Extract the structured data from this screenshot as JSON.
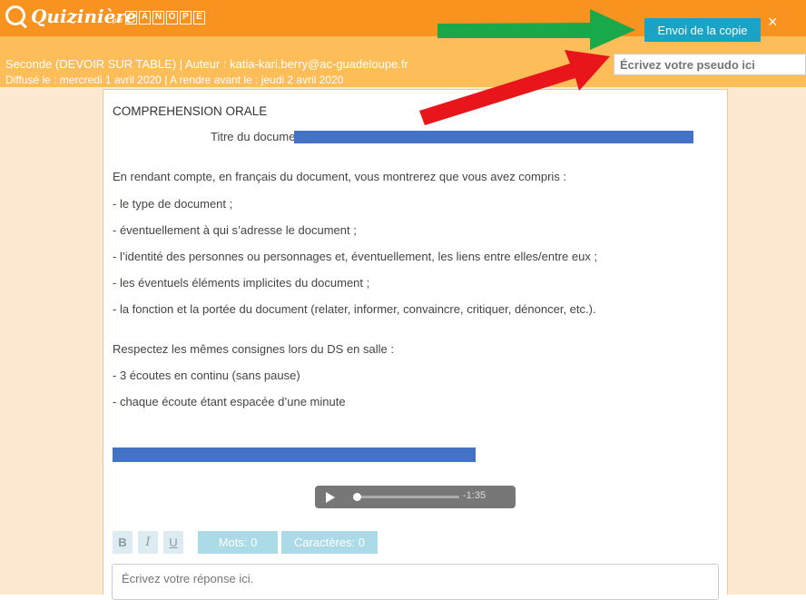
{
  "brand": {
    "name": "Quizinière",
    "par": "par",
    "partner_letters": [
      "C",
      "A",
      "N",
      "O",
      "P",
      "É"
    ]
  },
  "toolbar": {
    "send_label": "Envoi de la copie",
    "close_symbol": "×"
  },
  "header": {
    "meta_line1": "Seconde (DEVOIR SUR TABLE)  | Auteur : katia-kari.berry@ac-guadeloupe.fr",
    "meta_line2": "Diffusé le : mercredi 1 avril 2020  | A rendre avant le : jeudi 2 avril 2020",
    "pseudo_placeholder": "Écrivez votre pseudo ici"
  },
  "content": {
    "heading": "COMPREHENSION ORALE",
    "doc_title_label": "Titre du document : ",
    "intro": "En rendant compte, en français du document, vous montrerez que vous avez compris :",
    "bullets": [
      "- le type de document ;",
      "- éventuellement à qui s’adresse le document ;",
      "- l’identité des personnes ou personnages et, éventuellement, les liens entre elles/entre eux ;",
      "- les éventuels éléments implicites du document ;",
      "- la fonction et la portée du document (relater, informer, convaincre, critiquer, dénoncer, etc.)."
    ],
    "instructions_intro": "Respectez les mêmes consignes lors du DS en salle :",
    "instructions": [
      "- 3 écoutes en continu (sans pause)",
      "- chaque écoute étant espacée d’une minute"
    ]
  },
  "audio": {
    "time_remaining": "-1:35",
    "progress_fraction": 0.02
  },
  "editor": {
    "bold": "B",
    "italic": "I",
    "underline": "U",
    "words_label": "Mots: 0",
    "chars_label": "Caractères: 0",
    "answer_placeholder": "Écrivez votre réponse ici."
  },
  "colors": {
    "brand_orange": "#f7931e",
    "header_light_orange": "#fdbd58",
    "page_background": "#fde9d2",
    "button_blue": "#1aa3c5",
    "redaction_blue": "#4472c4",
    "arrow_green": "#19a94a",
    "arrow_red": "#e8161b"
  },
  "icons": {
    "logo": "quiziniere-q-logo-icon",
    "close": "close-icon",
    "play": "play-icon"
  }
}
